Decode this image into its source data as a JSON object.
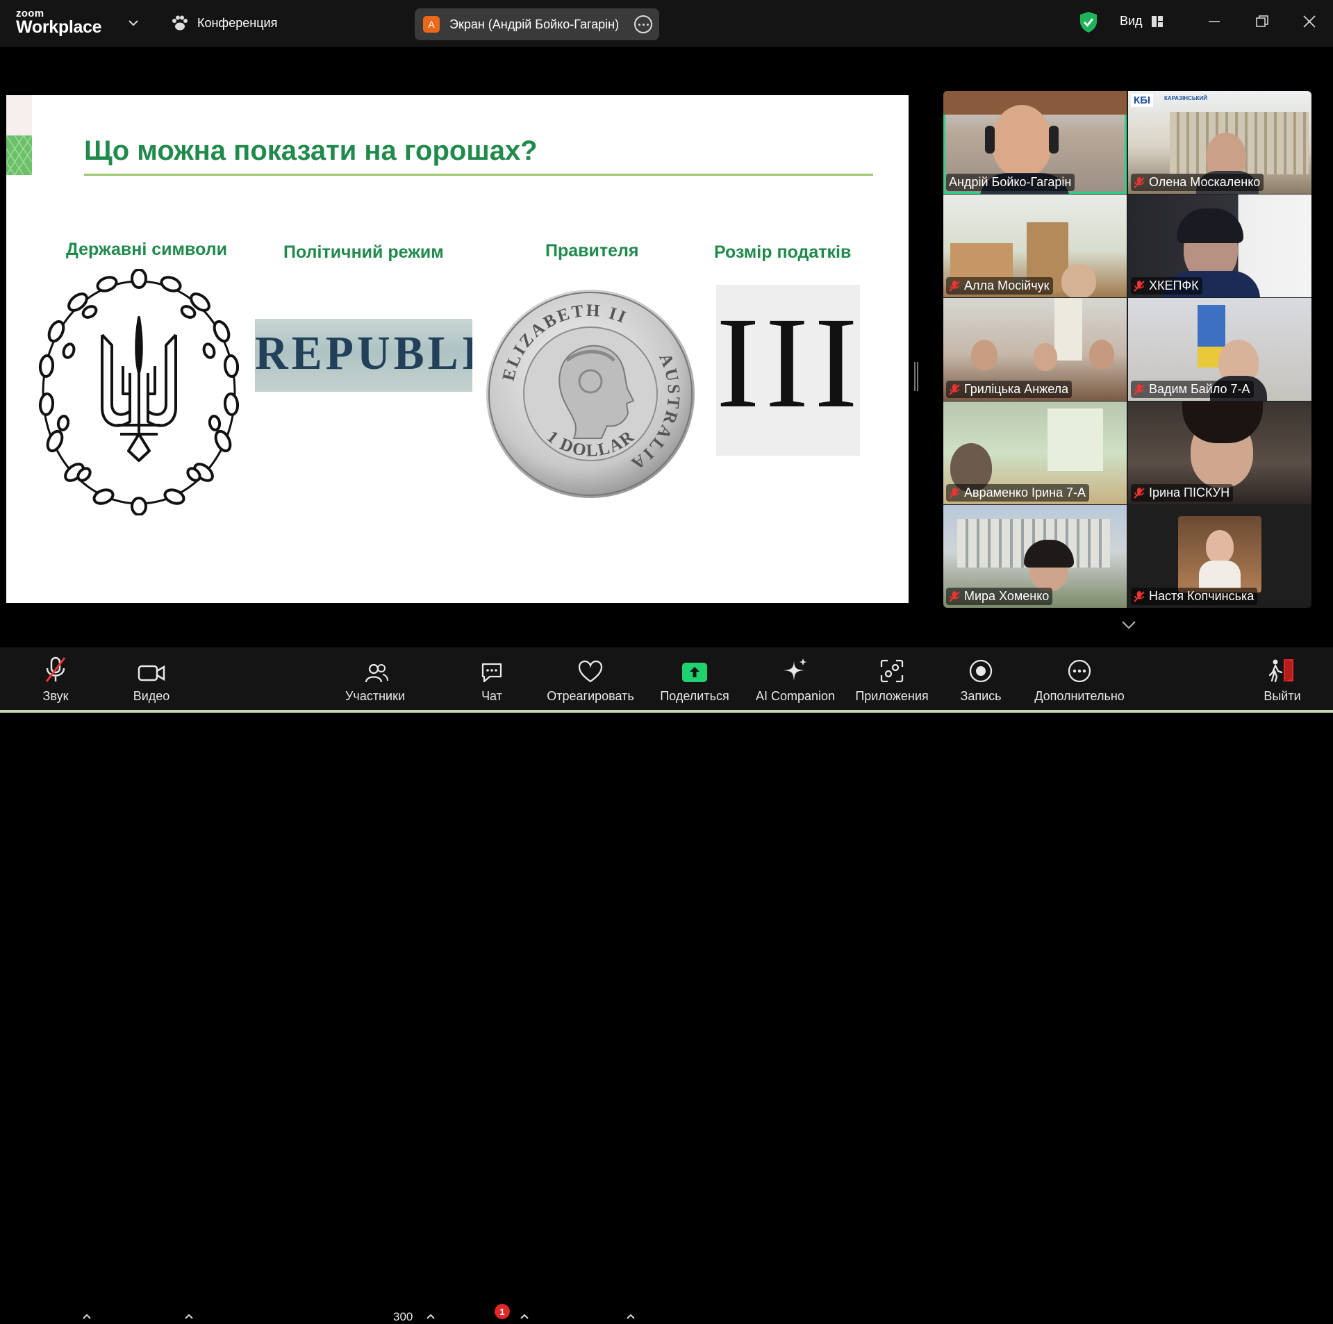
{
  "titlebar": {
    "logo_top": "zoom",
    "logo_bottom": "Workplace",
    "meeting_label": "Конференция",
    "share_badge": "A",
    "share_label": "Экран (Андрій Бойко-Гагарін)",
    "view_label": "Вид",
    "colors": {
      "shield": "#1fb35a",
      "share_badge": "#e8691b"
    }
  },
  "slide": {
    "title": "Що можна показати на горошах?",
    "columns": [
      {
        "label": "Державні символи"
      },
      {
        "label": "Політичний режим",
        "image_text": "REPUBLICA"
      },
      {
        "label": "Правителя",
        "coin_top": "ELIZABETH II",
        "coin_right": "AUSTRALIA",
        "coin_bottom": "1 DOLLAR"
      },
      {
        "label": "Розмір податків",
        "image_text": "III"
      }
    ],
    "colors": {
      "title": "#1f8a4c",
      "rule": "#9cc76a"
    }
  },
  "gallery": {
    "participants": [
      {
        "name": "Андрій Бойко-Гагарін",
        "muted": false,
        "active": true
      },
      {
        "name": "Олена Москаленко",
        "muted": true,
        "logo": "КБІ",
        "logo_sub": "КАРАЗІНСЬКИЙ"
      },
      {
        "name": "Алла Мосійчук",
        "muted": true
      },
      {
        "name": "ХКЕПФК",
        "muted": true
      },
      {
        "name": "Гриліцька Анжела",
        "muted": true
      },
      {
        "name": "Вадим Байло 7-А",
        "muted": true
      },
      {
        "name": "Авраменко Ірина 7-А",
        "muted": true
      },
      {
        "name": "Ірина ПІСКУН",
        "muted": true
      },
      {
        "name": "Мира Хоменко",
        "muted": true
      },
      {
        "name": "Настя Копчинська",
        "muted": true
      }
    ]
  },
  "toolbar": {
    "audio": "Звук",
    "video": "Видео",
    "participants": "Участники",
    "participants_count": "300",
    "chat": "Чат",
    "chat_badge": "1",
    "react": "Отреагировать",
    "share": "Поделиться",
    "ai": "AI Companion",
    "apps": "Приложения",
    "record": "Запись",
    "more": "Дополнительно",
    "leave": "Выйти",
    "colors": {
      "share": "#1fd16f",
      "leave": "#e02828",
      "badge": "#e02828"
    }
  }
}
